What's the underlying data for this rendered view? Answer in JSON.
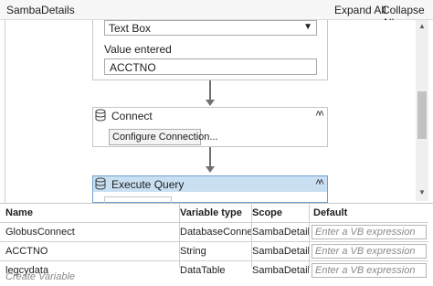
{
  "workflow": {
    "title": "SambaDetails"
  },
  "toolbar": {
    "expand_all": "Expand All",
    "collapse_all": "Collapse All"
  },
  "activity_top": {
    "dropdown_value": "Text Box",
    "value_label": "Value entered",
    "value_input": "ACCTNO"
  },
  "connect_activity": {
    "title": "Connect",
    "button_label": "Configure Connection...",
    "collapse_glyph": "˄˄"
  },
  "execute_activity": {
    "title": "Execute Query",
    "collapse_glyph": "˄˄"
  },
  "variables_panel": {
    "headers": {
      "name": "Name",
      "type": "Variable type",
      "scope": "Scope",
      "default": "Default"
    },
    "rows": [
      {
        "name": "GlobusConnect",
        "type": "DatabaseConnection",
        "scope": "SambaDetails",
        "default_placeholder": "Enter a VB expression"
      },
      {
        "name": "ACCTNO",
        "type": "String",
        "scope": "SambaDetails",
        "default_placeholder": "Enter a VB expression"
      },
      {
        "name": "legcydata",
        "type": "DataTable",
        "scope": "SambaDetails",
        "default_placeholder": "Enter a VB expression"
      }
    ],
    "create_label": "Create Variable"
  },
  "colors": {
    "selected_header": "#c9dff2",
    "selected_border": "#6ea0d0"
  }
}
